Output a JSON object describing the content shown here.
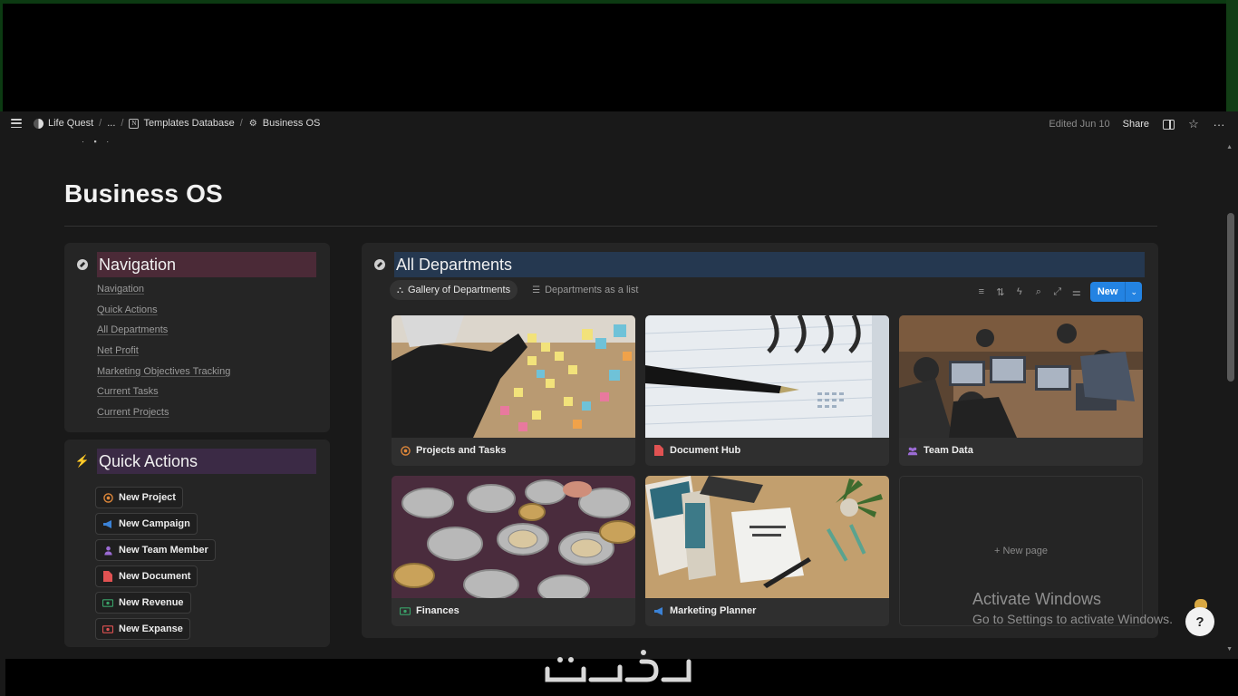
{
  "topbar": {
    "breadcrumbs": [
      {
        "label": "Life Quest",
        "icon": "life-quest-icon"
      },
      {
        "label": "..."
      },
      {
        "label": "Templates Database",
        "icon": "notion-icon"
      },
      {
        "label": "Business OS",
        "icon": "gear-icon"
      }
    ],
    "edited": "Edited Jun 10",
    "share": "Share"
  },
  "page": {
    "title": "Business OS"
  },
  "navigation": {
    "title": "Navigation",
    "links": [
      "Navigation",
      "Quick Actions",
      "All Departments",
      "Net Profit",
      "Marketing Objectives Tracking",
      "Current Tasks",
      "Current Projects"
    ]
  },
  "quick_actions": {
    "title": "Quick Actions",
    "buttons": [
      {
        "label": "New Project",
        "icon": "target-icon",
        "color": "#e0883a"
      },
      {
        "label": "New Campaign",
        "icon": "megaphone-icon",
        "color": "#3b82d6"
      },
      {
        "label": "New Team Member",
        "icon": "person-icon",
        "color": "#9b6bd4"
      },
      {
        "label": "New Document",
        "icon": "document-icon",
        "color": "#e05252"
      },
      {
        "label": "New Revenue",
        "icon": "money-icon",
        "color": "#3aa36a"
      },
      {
        "label": "New Expanse",
        "icon": "money-icon",
        "color": "#e05252"
      }
    ]
  },
  "departments": {
    "title": "All Departments",
    "views": [
      {
        "label": "Gallery of Departments",
        "active": true
      },
      {
        "label": "Departments as a list",
        "active": false
      }
    ],
    "new_button": "New",
    "cards": [
      {
        "label": "Projects and Tasks",
        "icon": "target-icon",
        "icon_color": "#e0883a"
      },
      {
        "label": "Document Hub",
        "icon": "document-icon",
        "icon_color": "#e05252"
      },
      {
        "label": "Team Data",
        "icon": "people-icon",
        "icon_color": "#9b6bd4"
      },
      {
        "label": "Finances",
        "icon": "money-icon",
        "icon_color": "#3aa36a"
      },
      {
        "label": "Marketing Planner",
        "icon": "megaphone-icon",
        "icon_color": "#3b82d6"
      }
    ],
    "new_page": "New page"
  },
  "watermark": {
    "line1": "Activate Windows",
    "line2": "Go to Settings to activate Windows."
  },
  "colors": {
    "accent": "#2383e2",
    "nav_highlight": "#4b2a37",
    "qa_highlight": "#3b2a45",
    "dept_highlight": "#253850"
  }
}
